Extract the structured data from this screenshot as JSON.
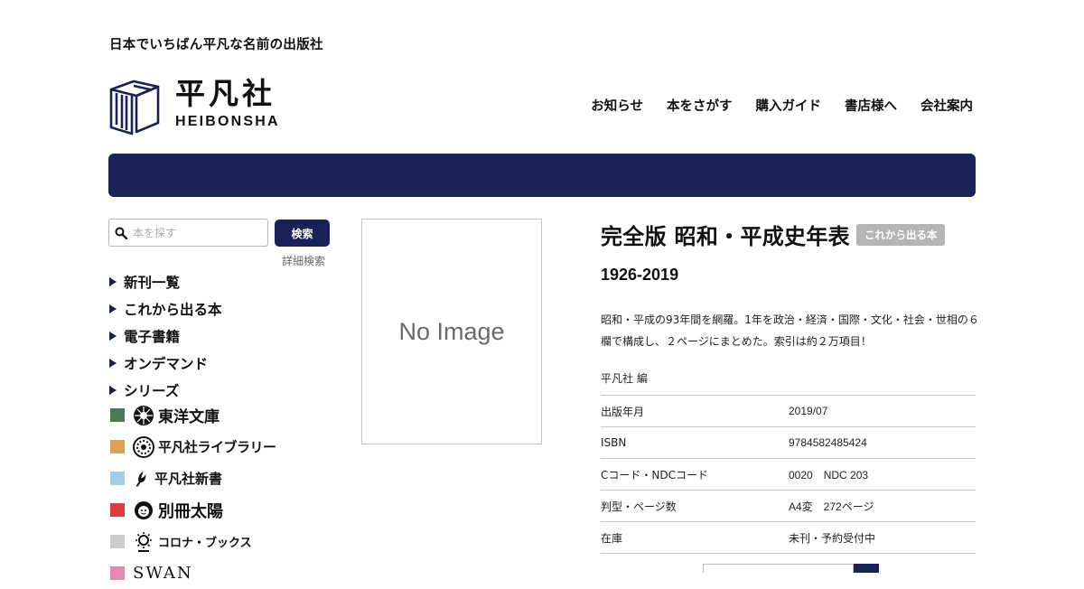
{
  "site": {
    "tagline": "日本でいちばん平凡な名前の出版社",
    "logo_jp": "平凡社",
    "logo_en": "HEIBONSHA"
  },
  "nav": [
    {
      "label": "お知らせ"
    },
    {
      "label": "本をさがす"
    },
    {
      "label": "購入ガイド"
    },
    {
      "label": "書店様へ"
    },
    {
      "label": "会社案内"
    }
  ],
  "colors": {
    "brand": "#1a2157",
    "badge": "#b5b5b5",
    "series": [
      "#4a7a58",
      "#dea055",
      "#a6cde8",
      "#e03a3e",
      "#cccccc",
      "#e887b3"
    ]
  },
  "search": {
    "placeholder": "本を探す",
    "button_label": "検索",
    "advanced_label": "詳細検索"
  },
  "sidebar": {
    "items": [
      {
        "label": "新刊一覧"
      },
      {
        "label": "これから出る本"
      },
      {
        "label": "電子書籍"
      },
      {
        "label": "オンデマンド"
      },
      {
        "label": "シリーズ"
      }
    ],
    "series": [
      {
        "name": "東洋文庫",
        "icon": "toyo-bunko-emblem-icon"
      },
      {
        "name": "平凡社ライブラリー",
        "icon": "heibonsha-library-emblem-icon"
      },
      {
        "name": "平凡社新書",
        "icon": "heibonsha-shinsho-emblem-icon"
      },
      {
        "name": "別冊太陽",
        "icon": "bessatsu-taiyo-emblem-icon"
      },
      {
        "name": "コロナ・ブックス",
        "icon": "corona-books-emblem-icon"
      },
      {
        "name": "SWAN",
        "icon": "swan-logo"
      }
    ]
  },
  "book": {
    "cover_text": "No Image",
    "title": "完全版 昭和・平成史年表",
    "badge": "これから出る本",
    "subtitle": "1926-2019",
    "description": "昭和・平成の93年間を網羅。1年を政治・経済・国際・文化・社会・世相の６欄で構成し、２ページにまとめた。索引は約２万項目！",
    "author": "平凡社 編",
    "specs": [
      {
        "key": "出版年月",
        "value": "2019/07"
      },
      {
        "key": "ISBN",
        "value": "9784582485424"
      },
      {
        "key": "Cコード・NDCコード",
        "value": "0020　NDC 203"
      },
      {
        "key": "判型・ページ数",
        "value": "A4変　272ページ"
      },
      {
        "key": "在庫",
        "value": "未刊・予約受付中"
      }
    ]
  }
}
